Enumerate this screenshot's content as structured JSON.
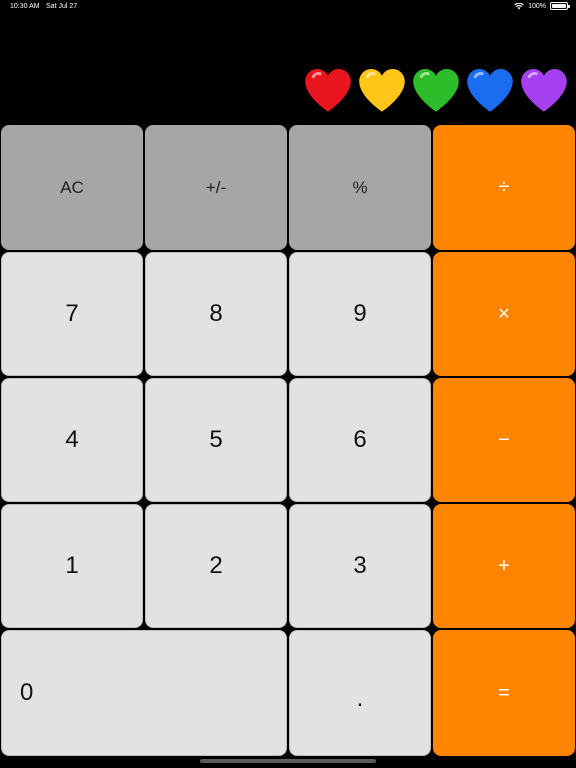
{
  "status_bar": {
    "time": "10:30 AM",
    "date": "Sat Jul 27",
    "battery": "100%"
  },
  "display": {
    "hearts": [
      {
        "icon": "red-heart-icon",
        "color": "#e8141e"
      },
      {
        "icon": "yellow-heart-icon",
        "color": "#ffc61a"
      },
      {
        "icon": "green-heart-icon",
        "color": "#2ebd2a"
      },
      {
        "icon": "blue-heart-icon",
        "color": "#1a6cf0"
      },
      {
        "icon": "purple-heart-icon",
        "color": "#a53ff0"
      }
    ]
  },
  "keys": {
    "ac": "AC",
    "plus_minus": "+/-",
    "percent": "%",
    "divide": "÷",
    "seven": "7",
    "eight": "8",
    "nine": "9",
    "multiply": "×",
    "four": "4",
    "five": "5",
    "six": "6",
    "minus": "−",
    "one": "1",
    "two": "2",
    "three": "3",
    "plus": "+",
    "zero": "0",
    "decimal": ".",
    "equals": "="
  },
  "colors": {
    "function_key": "#a6a6a6",
    "number_key": "#e2e2e2",
    "operator_key": "#ff8400",
    "background": "#000000"
  }
}
